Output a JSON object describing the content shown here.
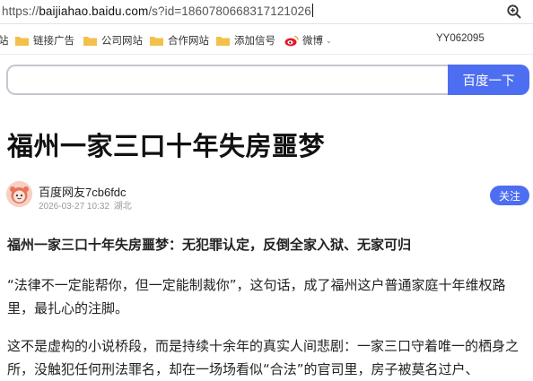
{
  "address_bar": {
    "url_prefix": "https://",
    "url_host": "baijiahao.baidu.com",
    "url_rest": "/s?id=1860780668317121026",
    "zoom_icon": "zoom-magnifier-icon"
  },
  "bookmarks": {
    "items": [
      {
        "label": "站",
        "icon": "folder-icon"
      },
      {
        "label": "链接广告",
        "icon": "folder-icon"
      },
      {
        "label": "公司网站",
        "icon": "folder-icon"
      },
      {
        "label": "合作网站",
        "icon": "folder-icon"
      },
      {
        "label": "添加信号",
        "icon": "folder-icon"
      },
      {
        "label": "微博",
        "icon": "weibo-icon"
      }
    ],
    "user_id": "YY062095"
  },
  "search": {
    "value": "",
    "button_label": "百度一下"
  },
  "article": {
    "title": "福州一家三口十年失房噩梦",
    "author": "百度网友7cb6fdc",
    "date": "2026-03-27 10:32",
    "location": "湖北",
    "follow_label": "关注",
    "paragraphs": [
      "福州一家三口十年失房噩梦：无犯罪认定，反倒全家入狱、无家可归",
      "“法律不一定能帮你，但一定能制裁你”，这句话，成了福州这户普通家庭十年维权路里，最扎心的注脚。",
      "这不是虚构的小说桥段，而是持续十余年的真实人间悲剧：一家三口守着唯一的栖身之所，没触犯任何刑法罪名，却在一场场看似“合法”的官司里，房子被莫名过户、"
    ]
  },
  "colors": {
    "accent": "#4e6ef2",
    "folder": "#f3c04a",
    "weibo_red": "#e6162d"
  }
}
